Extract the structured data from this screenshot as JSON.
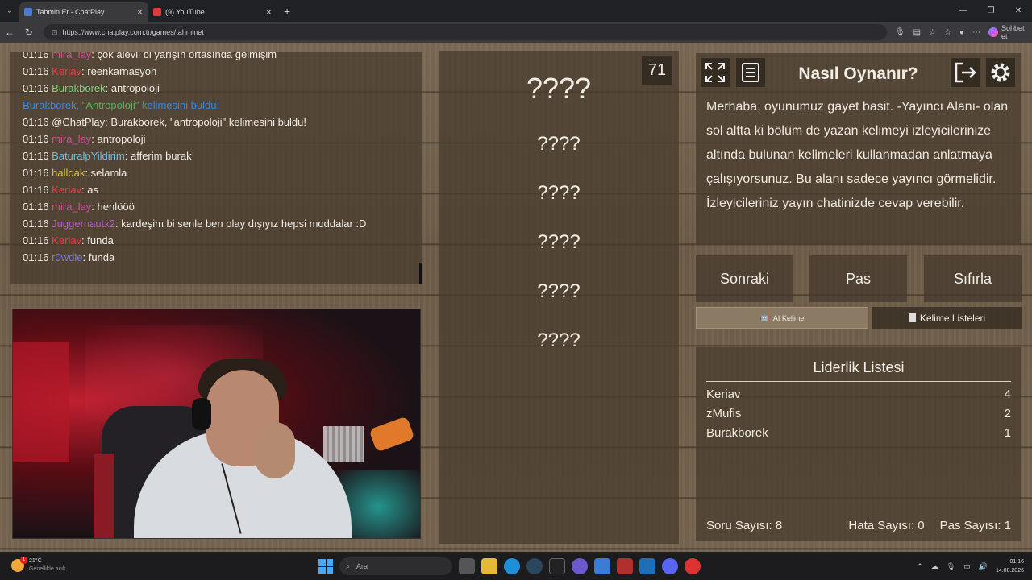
{
  "browser": {
    "tabs": [
      {
        "title": "Tahmin Et - ChatPlay",
        "active": true,
        "favicon_color": "#4a7fd0"
      },
      {
        "title": "(9) YouTube",
        "active": false,
        "favicon_color": "#e53935"
      }
    ],
    "url": "https://www.chatplay.com.tr/games/tahminet",
    "sohbet_label": "Sohbet et"
  },
  "chat": {
    "messages": [
      {
        "time": "01:16",
        "user": "mira_lay",
        "user_color": "#d64aa0",
        "text": "çok alevli bi yarışın ortasında gelmişim"
      },
      {
        "time": "01:16",
        "user": "Keriav",
        "user_color": "#e0404a",
        "text": "reenkarnasyon"
      },
      {
        "time": "01:16",
        "user": "Burakborek",
        "user_color": "#78d27a",
        "text": "antropoloji"
      },
      {
        "notice": true,
        "prefix": "Burakborek, ",
        "word": "\"Antropoloji\"",
        "suffix": " kelimesini buldu!"
      },
      {
        "time": "01:16",
        "user": "@ChatPlay",
        "user_color": "#f0ebe3",
        "text": "Burakborek, \"antropoloji\" kelimesini buldu!"
      },
      {
        "time": "01:16",
        "user": "mira_lay",
        "user_color": "#d64aa0",
        "text": "antropoloji"
      },
      {
        "time": "01:16",
        "user": "BaturalpYildirim",
        "user_color": "#6ec0e0",
        "text": "afferim burak"
      },
      {
        "time": "01:16",
        "user": "halloak",
        "user_color": "#d4c44a",
        "text": "selamla"
      },
      {
        "time": "01:16",
        "user": "Keriav",
        "user_color": "#e0404a",
        "text": "as"
      },
      {
        "time": "01:16",
        "user": "mira_lay",
        "user_color": "#d64aa0",
        "text": "henlööö"
      },
      {
        "time": "01:16",
        "user": "Juggernautx2",
        "user_color": "#b45ad8",
        "text": "kardeşim bi senle ben olay dışıyız hepsi moddalar :D"
      },
      {
        "time": "01:16",
        "user": "Keriav",
        "user_color": "#e0404a",
        "text": "funda"
      },
      {
        "time": "01:16",
        "user": "r0wdie",
        "user_color": "#7a78e0",
        "text": "funda"
      }
    ]
  },
  "game": {
    "timer": "71",
    "words": [
      "????",
      "????",
      "????",
      "????",
      "????",
      "????"
    ]
  },
  "howto": {
    "title": "Nasıl Oynanır?",
    "text": "Merhaba, oyunumuz gayet basit. -Yayıncı Alanı- olan sol altta ki bölüm de yazan kelimeyi izleyicilerinize altında bulunan kelimeleri kullanmadan anlatmaya çalışıyorsunuz. Bu alanı sadece yayıncı görmelidir. İzleyicileriniz yayın chatinizde cevap verebilir."
  },
  "actions": {
    "next": "Sonraki",
    "pass": "Pas",
    "reset": "Sıfırla",
    "ai_word": "AI Kelime",
    "word_lists": "Kelime Listeleri"
  },
  "leaderboard": {
    "title": "Liderlik Listesi",
    "rows": [
      {
        "name": "Keriav",
        "score": "4"
      },
      {
        "name": "zMufis",
        "score": "2"
      },
      {
        "name": "Burakborek",
        "score": "1"
      }
    ],
    "stats": {
      "questions": "Soru Sayısı: 8",
      "errors": "Hata Sayısı: 0",
      "passes": "Pas Sayısı: 1"
    }
  },
  "taskbar": {
    "weather_temp": "21°C",
    "weather_desc": "Genellikle açık",
    "search_placeholder": "Ara",
    "time": "01:16",
    "date": "14.08.2026",
    "notification_count": "1"
  }
}
